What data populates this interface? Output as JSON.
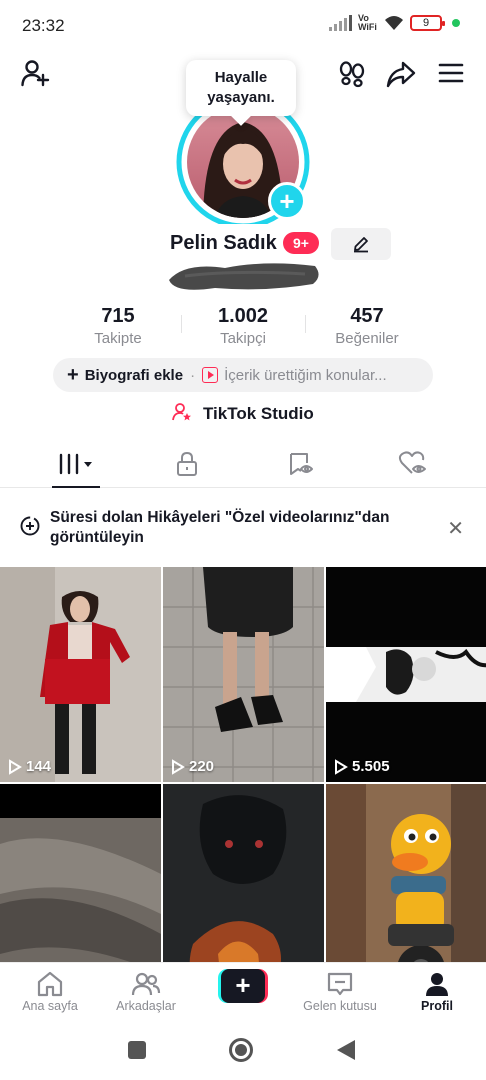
{
  "status_bar": {
    "time": "23:32",
    "vowifi": "Vo WiFi",
    "battery": "9"
  },
  "profile": {
    "story_bubble": "Hayalle yaşayanı.",
    "name": "Pelin Sadık",
    "badge": "9+",
    "stats": [
      {
        "value": "715",
        "label": "Takipte"
      },
      {
        "value": "1.002",
        "label": "Takipçi"
      },
      {
        "value": "457",
        "label": "Beğeniler"
      }
    ],
    "bio_add": "Biyografi ekle",
    "bio_content": "İçerik ürettiğim konular...",
    "studio": "TikTok Studio"
  },
  "notice": {
    "text": "Süresi dolan Hikâyeleri \"Özel videolarınız\"dan görüntüleyin"
  },
  "videos": [
    {
      "views": "144"
    },
    {
      "views": "220"
    },
    {
      "views": "5.505"
    },
    {
      "views": ""
    },
    {
      "views": ""
    },
    {
      "views": ""
    }
  ],
  "bottom_nav": {
    "home": "Ana sayfa",
    "friends": "Arkadaşlar",
    "inbox": "Gelen kutusu",
    "profile": "Profil"
  },
  "colors": {
    "accent": "#fe2c55",
    "cyan": "#20d5ec",
    "text": "#161823",
    "muted": "#8a8b91"
  }
}
